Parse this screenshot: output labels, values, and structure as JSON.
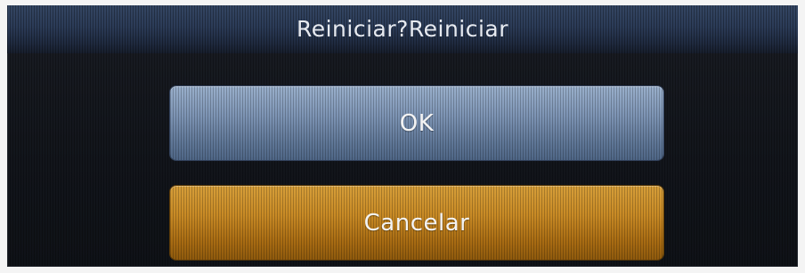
{
  "dialog": {
    "title": "Reiniciar?Reiniciar",
    "ok_label": "OK",
    "cancel_label": "Cancelar"
  },
  "colors": {
    "title_bar": "#2b3b57",
    "ok_button": "#7d94b4",
    "cancel_button": "#c88a25",
    "background": "#12151b"
  }
}
